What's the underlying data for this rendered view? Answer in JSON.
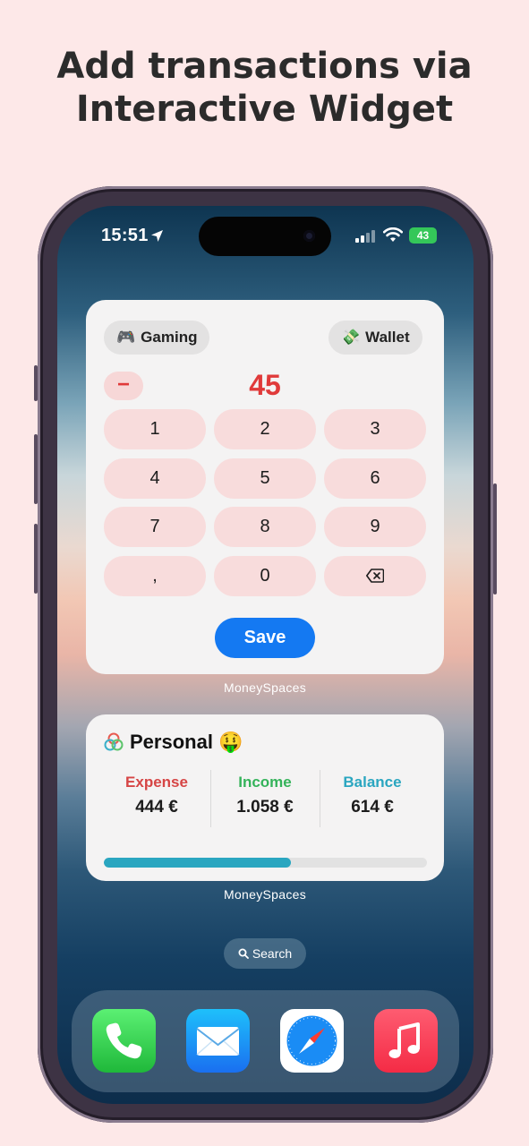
{
  "headline": {
    "line1": "Add transactions via",
    "line2": "Interactive Widget"
  },
  "status_bar": {
    "time": "15:51",
    "battery": "43"
  },
  "keypad_widget": {
    "category": {
      "emoji": "🎮",
      "label": "Gaming"
    },
    "account": {
      "emoji": "💸",
      "label": "Wallet"
    },
    "sign": "−",
    "amount": "45",
    "keys": [
      "1",
      "2",
      "3",
      "4",
      "5",
      "6",
      "7",
      "8",
      "9",
      ",",
      "0",
      "⌫"
    ],
    "save_label": "Save",
    "app_label": "MoneySpaces"
  },
  "summary_widget": {
    "space_name": "Personal",
    "space_emoji": "🤑",
    "expense": {
      "label": "Expense",
      "value": "444 €",
      "color": "#d64545"
    },
    "income": {
      "label": "Income",
      "value": "1.058 €",
      "color": "#34b35a"
    },
    "balance": {
      "label": "Balance",
      "value": "614 €",
      "color": "#2aa6c0"
    },
    "progress_fraction": 0.58,
    "app_label": "MoneySpaces"
  },
  "search": {
    "label": "Search",
    "icon": "search-icon"
  },
  "dock": {
    "apps": [
      {
        "name": "Phone",
        "icon": "phone-icon",
        "color": "#34c759"
      },
      {
        "name": "Mail",
        "icon": "mail-icon",
        "color": "#1a8cf5"
      },
      {
        "name": "Safari",
        "icon": "safari-icon",
        "color": "#1a8cf5"
      },
      {
        "name": "Music",
        "icon": "music-icon",
        "color": "#fa3c55"
      }
    ]
  }
}
